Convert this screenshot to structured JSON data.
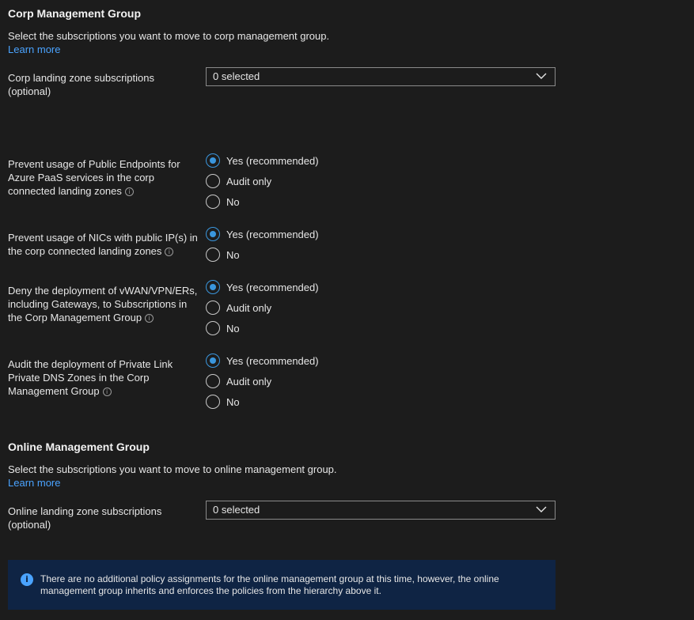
{
  "corp": {
    "title": "Corp Management Group",
    "description": "Select the subscriptions you want to move to corp management group.",
    "learn_more": "Learn more",
    "subs_label_line1": "Corp landing zone subscriptions",
    "subs_label_line2": "(optional)",
    "subs_value": "0 selected"
  },
  "questions": [
    {
      "label_lines": [
        "Prevent usage of Public Endpoints for",
        "Azure PaaS services in the corp",
        "connected landing zones"
      ],
      "options": [
        "Yes (recommended)",
        "Audit only",
        "No"
      ],
      "selected": "Yes (recommended)"
    },
    {
      "label_lines": [
        "Prevent usage of NICs with public IP(s) in",
        "the corp connected landing zones"
      ],
      "options": [
        "Yes (recommended)",
        "No"
      ],
      "selected": "Yes (recommended)"
    },
    {
      "label_lines": [
        "Deny the deployment of vWAN/VPN/ERs,",
        "including Gateways, to Subscriptions in",
        "the Corp Management Group"
      ],
      "options": [
        "Yes (recommended)",
        "Audit only",
        "No"
      ],
      "selected": "Yes (recommended)"
    },
    {
      "label_lines": [
        "Audit the deployment of Private Link",
        "Private DNS Zones in the Corp",
        "Management Group"
      ],
      "options": [
        "Yes (recommended)",
        "Audit only",
        "No"
      ],
      "selected": "Yes (recommended)"
    }
  ],
  "online": {
    "title": "Online Management Group",
    "description": "Select the subscriptions you want to move to online management group.",
    "learn_more": "Learn more",
    "subs_label_line1": "Online landing zone subscriptions",
    "subs_label_line2": "(optional)",
    "subs_value": "0 selected"
  },
  "info": {
    "icon": "info-icon",
    "line1": "There are no additional policy assignments for the online management group at this time, however, the online",
    "line2": "management group inherits and enforces the policies from the hierarchy above it."
  },
  "colors": {
    "background": "#1c1c1c",
    "accent": "#3a96dd",
    "link": "#4aa3ff",
    "info_bg": "#0f2444"
  }
}
